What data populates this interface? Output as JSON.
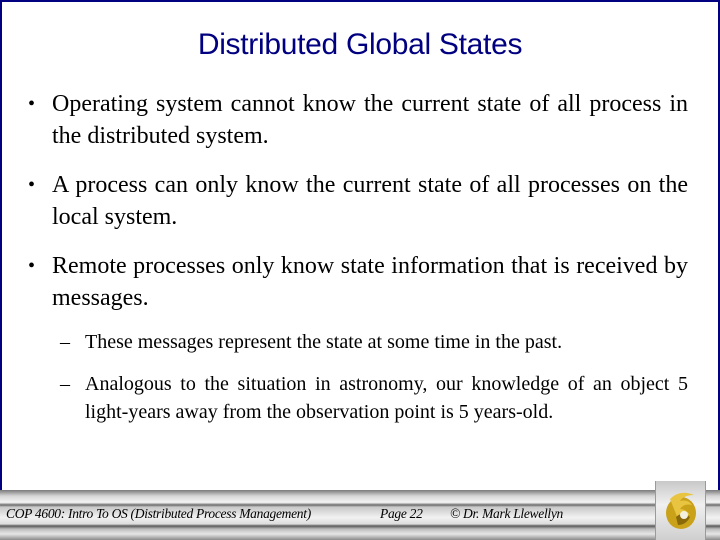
{
  "slide": {
    "title": "Distributed Global States",
    "bullets": [
      {
        "mark": "•",
        "text": "Operating system cannot know the current state of all process in the distributed system."
      },
      {
        "mark": "•",
        "text": "A process can only know the current state of all processes on the local system."
      },
      {
        "mark": "•",
        "text": "Remote processes only know state information that is received by messages.",
        "sub_bullets": [
          {
            "mark": "–",
            "text": "These messages represent the state at some time in the past."
          },
          {
            "mark": "–",
            "text": "Analogous to the situation in astronomy, our knowledge of an object 5 light-years away from the observation point is 5 years-old."
          }
        ]
      }
    ]
  },
  "footer": {
    "course": "COP 4600: Intro To OS  (Distributed Process Management)",
    "page": "Page 22",
    "copyright": "© Dr. Mark Llewellyn",
    "logo_icon": "pegasus-logo-icon"
  },
  "colors": {
    "title": "#000080",
    "frame": "#000080",
    "logo_gold": "#c9a21a"
  }
}
